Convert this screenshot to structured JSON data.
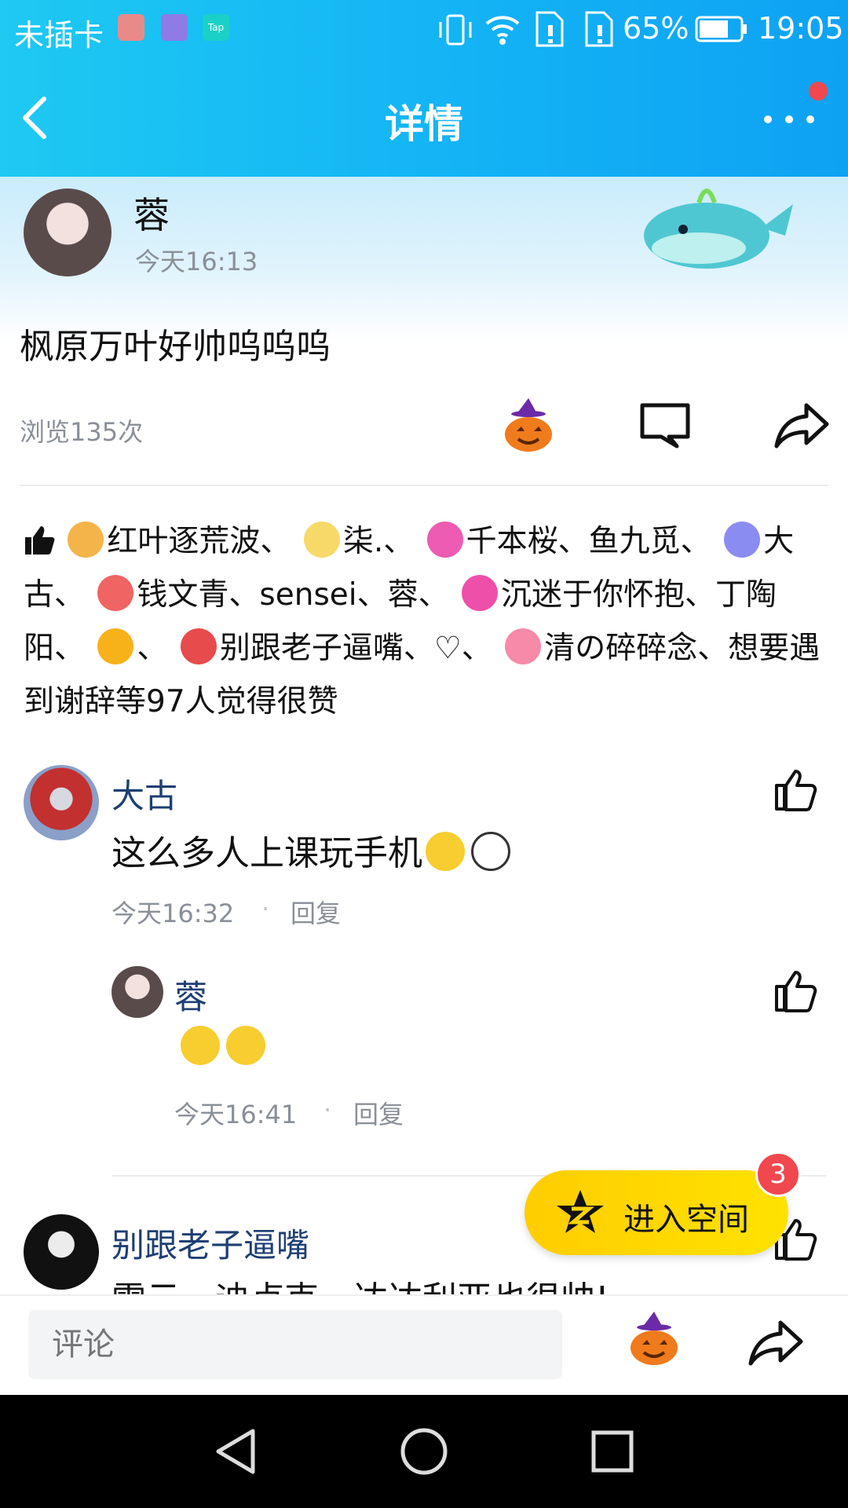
{
  "status_bar": {
    "carrier": "未插卡",
    "battery_pct": "65%",
    "time": "19:05"
  },
  "header": {
    "title": "详情"
  },
  "post": {
    "author": "蓉",
    "time": "今天16:13",
    "content": "枫原万叶好帅呜呜呜",
    "views": "浏览135次"
  },
  "likes": {
    "names": [
      "红叶逐荒波、",
      "柒.、",
      "千本桜、鱼九觅、",
      "大古、",
      "钱文青、sensei、蓉、",
      "沉迷于你怀抱、丁陶阳、",
      "、",
      "别跟老子逼嘴、♡、",
      "清の碎碎念、想要遇到谢辞等97人觉得很赞"
    ]
  },
  "comments": [
    {
      "author": "大古",
      "text": "这么多人上课玩手机",
      "time": "今天16:32",
      "reply": "回复"
    },
    {
      "author": "蓉",
      "text": "",
      "time": "今天16:41",
      "reply": "回复"
    },
    {
      "author": "别跟老子逼嘴",
      "text": "雷云、迪卢克、达达利亚也很帅!"
    }
  ],
  "float_button": {
    "label": "进入空间",
    "badge": "3"
  },
  "comment_input": {
    "placeholder": "评论"
  },
  "colors": {
    "accent": "#13b3f5",
    "name_blue": "#1d3f73",
    "badge_red": "#f0484e"
  }
}
